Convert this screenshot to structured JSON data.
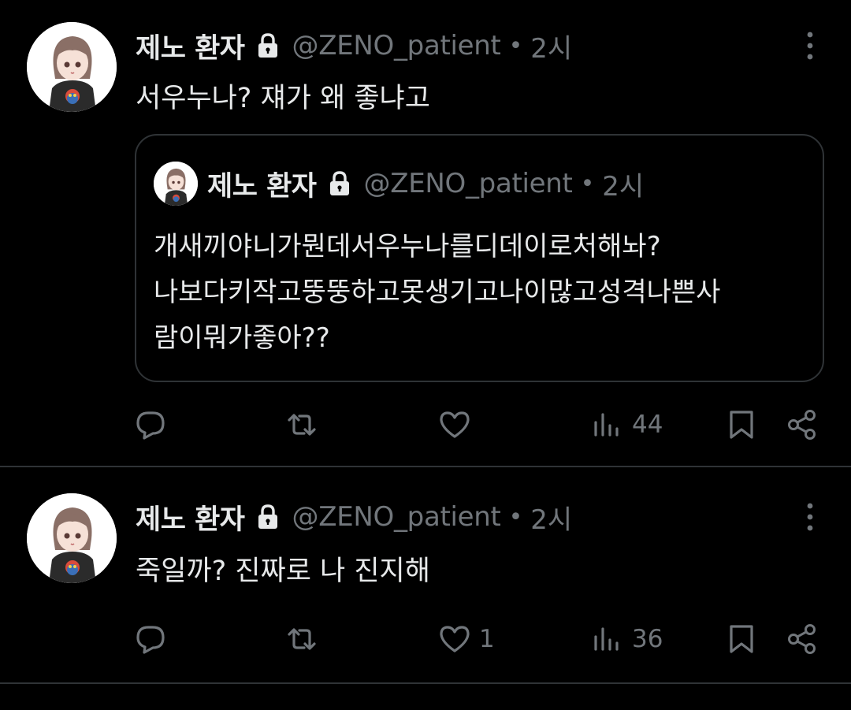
{
  "colors": {
    "background": "#000000",
    "text_primary": "#e7e9ea",
    "text_secondary": "#71767b",
    "divider": "#2f3336"
  },
  "tweets": [
    {
      "display_name": "제노 환자",
      "handle": "@ZENO_patient",
      "separator": "•",
      "time": "2시",
      "text": "서우누나? 쟤가 왜 좋냐고",
      "quote": {
        "display_name": "제노 환자",
        "handle": "@ZENO_patient",
        "separator": "•",
        "time": "2시",
        "lines": [
          "개새끼야니가뭔데서우누나를디데이로처해놔?",
          "나보다키작고뚱뚱하고못생기고나이많고성격나쁜사",
          "람이뭐가좋아??"
        ]
      },
      "actions": {
        "reply_icon": "reply-icon",
        "retweet_icon": "retweet-icon",
        "like_icon": "heart-icon",
        "like_count": "",
        "views_icon": "views-icon",
        "views_count": "44",
        "bookmark_icon": "bookmark-icon",
        "share_icon": "share-icon"
      }
    },
    {
      "display_name": "제노 환자",
      "handle": "@ZENO_patient",
      "separator": "•",
      "time": "2시",
      "text": "죽일까? 진짜로 나 진지해",
      "actions": {
        "reply_icon": "reply-icon",
        "retweet_icon": "retweet-icon",
        "like_icon": "heart-icon",
        "like_count": "1",
        "views_icon": "views-icon",
        "views_count": "36",
        "bookmark_icon": "bookmark-icon",
        "share_icon": "share-icon"
      }
    }
  ]
}
